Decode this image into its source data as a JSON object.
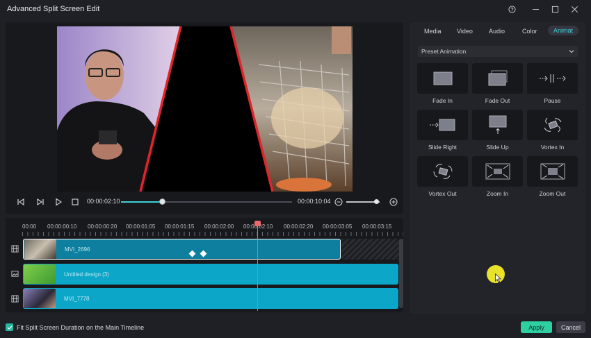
{
  "window": {
    "title": "Advanced Split Screen Edit",
    "buttons": [
      "help-icon",
      "minimize-icon",
      "maximize-icon",
      "close-icon"
    ]
  },
  "player": {
    "current_time": "00:00:02:10",
    "total_time": "00:00:10:04",
    "progress": 0.24,
    "zoom_level": 0.9
  },
  "timeline": {
    "ruler": [
      "00:00",
      "00:00:00:10",
      "00:00:00:20",
      "00:00:01:05",
      "00:00:01:15",
      "00:00:02:00",
      "00:00:02:10",
      "00:00:02:20",
      "00:00:03:05",
      "00:00:03:15"
    ],
    "tracks": [
      {
        "type": "video",
        "label": "MVI_2696",
        "selected": true
      },
      {
        "type": "image",
        "label": "Untitled design (3)",
        "selected": false
      },
      {
        "type": "video",
        "label": "MVI_7778",
        "selected": false
      }
    ]
  },
  "panel": {
    "tabs": [
      "Media",
      "Video",
      "Audio",
      "Color",
      "Animat"
    ],
    "active_tab": "Animat",
    "dropdown": "Preset Animation",
    "animations": [
      "Fade In",
      "Fade Out",
      "Pause",
      "Slide Right",
      "Slide Up",
      "Vortex In",
      "Vortex Out",
      "Zoom In",
      "Zoom Out"
    ]
  },
  "footer": {
    "checkbox_label": "Fit Split Screen Duration on the Main Timeline",
    "checked": true,
    "apply": "Apply",
    "cancel": "Cancel"
  },
  "colors": {
    "accent": "#3fd0d6",
    "clip": "#0ca6c8",
    "apply": "#2ed0a2",
    "divider": "#e0242b",
    "playhead": "#e86a6a"
  }
}
